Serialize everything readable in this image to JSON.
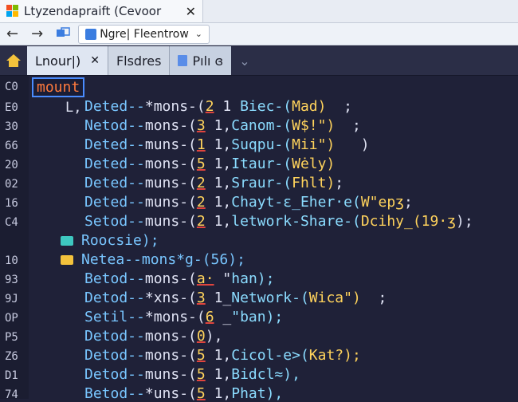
{
  "window": {
    "title": "Ltyzendapraift (Cevoor",
    "close_glyph": "✕"
  },
  "toolbar": {
    "back_glyph": "←",
    "forward_glyph": "→",
    "address": "Ngre| Fleentrow",
    "dropdown_glyph": "⌄"
  },
  "tabs": [
    {
      "label": "Lnour|)",
      "close": "✕",
      "state": "active"
    },
    {
      "label": "Flsdres",
      "state": "inactive"
    },
    {
      "label": "Pılı ɞ",
      "state": "alt",
      "dropdown": "⌄"
    }
  ],
  "gutter": [
    "C0",
    "E0",
    "30",
    "66",
    "20",
    "02",
    "16",
    "C4",
    "",
    "10",
    "93",
    "9J",
    "OP",
    "P5",
    "Z6",
    "D1",
    "74"
  ],
  "code": {
    "header": "mount",
    "tree_glyph": "L,",
    "lines": [
      {
        "a": "Deted--",
        "b": "*mons-(",
        "n": "2",
        "c": " 1 ",
        "f": "Biec-(",
        "s": "Mad)",
        "t": "  ;"
      },
      {
        "a": "Netod--",
        "b": "mons-(",
        "n": "3",
        "c": " 1,",
        "f": "Canom-(",
        "s": "W$!\")",
        "t": "  ;"
      },
      {
        "a": "Deted--",
        "b": "muns-(",
        "n": "1",
        "c": " 1,",
        "f": "Suqpu-(",
        "s": "Mii\")",
        "t": "   )"
      },
      {
        "a": "Deted--",
        "b": "mons-(",
        "n": "5",
        "c": " 1,",
        "f": "Itaur-(",
        "s": "Wėly)",
        "t": ""
      },
      {
        "a": "Deted--",
        "b": "muns-(",
        "n": "2",
        "c": " 1,",
        "f": "Sraur-(",
        "s": "Fhlt)",
        "t": ";"
      },
      {
        "a": "Deted--",
        "b": "muns-(",
        "n": "2",
        "c": " 1,",
        "f": "Chayt-ɛ_Eher·e(",
        "s": "W\"epʒ",
        "t": ";"
      },
      {
        "a": "Setod--",
        "b": "muns-(",
        "n": "2",
        "c": " 1,",
        "f": "letwork-Share-(",
        "s": "Dcihy_(19·ʒ",
        "t": ");"
      },
      {
        "folder": "Roocsie);"
      },
      {
        "folder": "Netea--mons*g-(56);"
      },
      {
        "a": "Betod--",
        "b": "mons-(",
        "n": "a·",
        "c": " \"",
        "f": "han);",
        "s": "",
        "t": ""
      },
      {
        "a": "Detod--",
        "b": "*xns-(",
        "n": "3",
        "c": " 1_",
        "f": "Network-(",
        "s": "Wica\")",
        "t": "  ;"
      },
      {
        "a": "Setil--",
        "b": "*mons-(",
        "n": "6",
        "c": " _",
        "f": "\"ban);",
        "s": "",
        "t": ""
      },
      {
        "a": "Detod--",
        "b": "mons-(",
        "n": "0",
        "c": "),",
        "f": "",
        "s": "",
        "t": ""
      },
      {
        "a": "Detod--",
        "b": "mons-(",
        "n": "5",
        "c": " 1,",
        "f": "Cicol-e>(",
        "s": "Kat?);",
        "t": ""
      },
      {
        "a": "Detod--",
        "b": "muns-(",
        "n": "5",
        "c": " 1,",
        "f": "Bidcl≈),",
        "s": "",
        "t": ""
      },
      {
        "a": "Betod--",
        "b": "*uns-(",
        "n": "5",
        "c": " 1,",
        "f": "Phat),",
        "s": "",
        "t": ""
      }
    ]
  },
  "colors": {
    "editor_bg": "#1f2138",
    "keyword": "#79c6ff",
    "number": "#ffd35c",
    "error_underline": "#e0443e",
    "header": "#ff7a3d"
  }
}
